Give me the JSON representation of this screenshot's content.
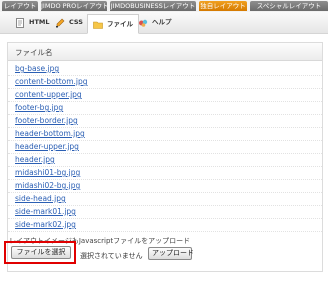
{
  "top_tabs": [
    {
      "label": "レイアウト",
      "active": false
    },
    {
      "label": "JIMDO PROレイアウト",
      "active": false
    },
    {
      "label": "JIMDOBUSINESSレイアウト",
      "active": false
    },
    {
      "label": "独自レイアウト",
      "active": true
    },
    {
      "label": "スペシャルレイアウト",
      "active": false
    }
  ],
  "sub_tabs": [
    {
      "label": "HTML",
      "icon": "html-file-icon",
      "active": false
    },
    {
      "label": "CSS",
      "icon": "css-brush-icon",
      "active": false
    },
    {
      "label": "ファイル",
      "icon": "folder-icon",
      "active": true
    },
    {
      "label": "ヘルプ",
      "icon": "help-icon",
      "active": false
    }
  ],
  "file_list": {
    "column_header": "ファイル名",
    "files": [
      "bg-base.jpg",
      "content-bottom.jpg",
      "content-upper.jpg",
      "footer-bg.jpg",
      "footer-border.jpg",
      "header-bottom.jpg",
      "header-upper.jpg",
      "header.jpg",
      "midashi01-bg.jpg",
      "midashi02-bg.jpg",
      "side-head.jpg",
      "side-mark01.jpg",
      "side-mark02.jpg"
    ]
  },
  "upload": {
    "label": "レイアウトイメージもJavascriptファイルをアップロード",
    "choose_button": "ファイルを選択",
    "status": "選択されていません",
    "upload_button": "アップロード"
  },
  "colors": {
    "active_tab": "#e38a00",
    "inactive_tab": "#7a7a7a",
    "link": "#2b5fb4",
    "highlight_box": "#e00000"
  }
}
